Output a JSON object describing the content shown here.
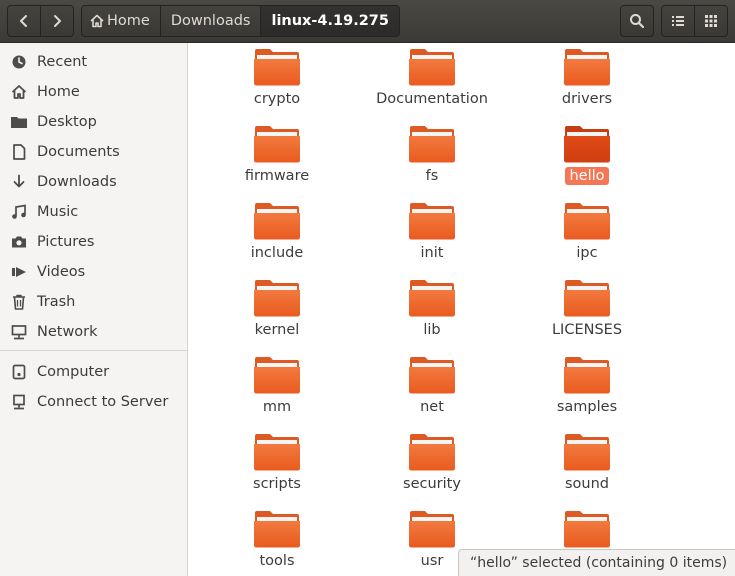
{
  "header": {
    "breadcrumbs": [
      {
        "label": "Home",
        "icon": "home-icon"
      },
      {
        "label": "Downloads"
      },
      {
        "label": "linux-4.19.275",
        "active": true
      }
    ]
  },
  "sidebar": {
    "items": [
      {
        "label": "Recent",
        "icon": "clock-icon"
      },
      {
        "label": "Home",
        "icon": "home-icon"
      },
      {
        "label": "Desktop",
        "icon": "folder-icon"
      },
      {
        "label": "Documents",
        "icon": "document-icon"
      },
      {
        "label": "Downloads",
        "icon": "download-icon"
      },
      {
        "label": "Music",
        "icon": "music-icon"
      },
      {
        "label": "Pictures",
        "icon": "camera-icon"
      },
      {
        "label": "Videos",
        "icon": "video-icon"
      },
      {
        "label": "Trash",
        "icon": "trash-icon"
      },
      {
        "label": "Network",
        "icon": "network-icon"
      }
    ],
    "devices": [
      {
        "label": "Computer",
        "icon": "computer-icon"
      },
      {
        "label": "Connect to Server",
        "icon": "server-icon"
      }
    ]
  },
  "files": [
    {
      "label": "crypto"
    },
    {
      "label": "Documentation"
    },
    {
      "label": "drivers"
    },
    {
      "label": "firmware"
    },
    {
      "label": "fs"
    },
    {
      "label": "hello",
      "selected": true
    },
    {
      "label": "include"
    },
    {
      "label": "init"
    },
    {
      "label": "ipc"
    },
    {
      "label": "kernel"
    },
    {
      "label": "lib"
    },
    {
      "label": "LICENSES"
    },
    {
      "label": "mm"
    },
    {
      "label": "net"
    },
    {
      "label": "samples"
    },
    {
      "label": "scripts"
    },
    {
      "label": "security"
    },
    {
      "label": "sound"
    },
    {
      "label": "tools"
    },
    {
      "label": "usr"
    },
    {
      "label": ""
    }
  ],
  "status": {
    "text": "“hello” selected  (containing 0 items)"
  },
  "colors": {
    "folder": "#e95420",
    "selection": "#f37755",
    "headerbar": "#3f3e3a"
  }
}
